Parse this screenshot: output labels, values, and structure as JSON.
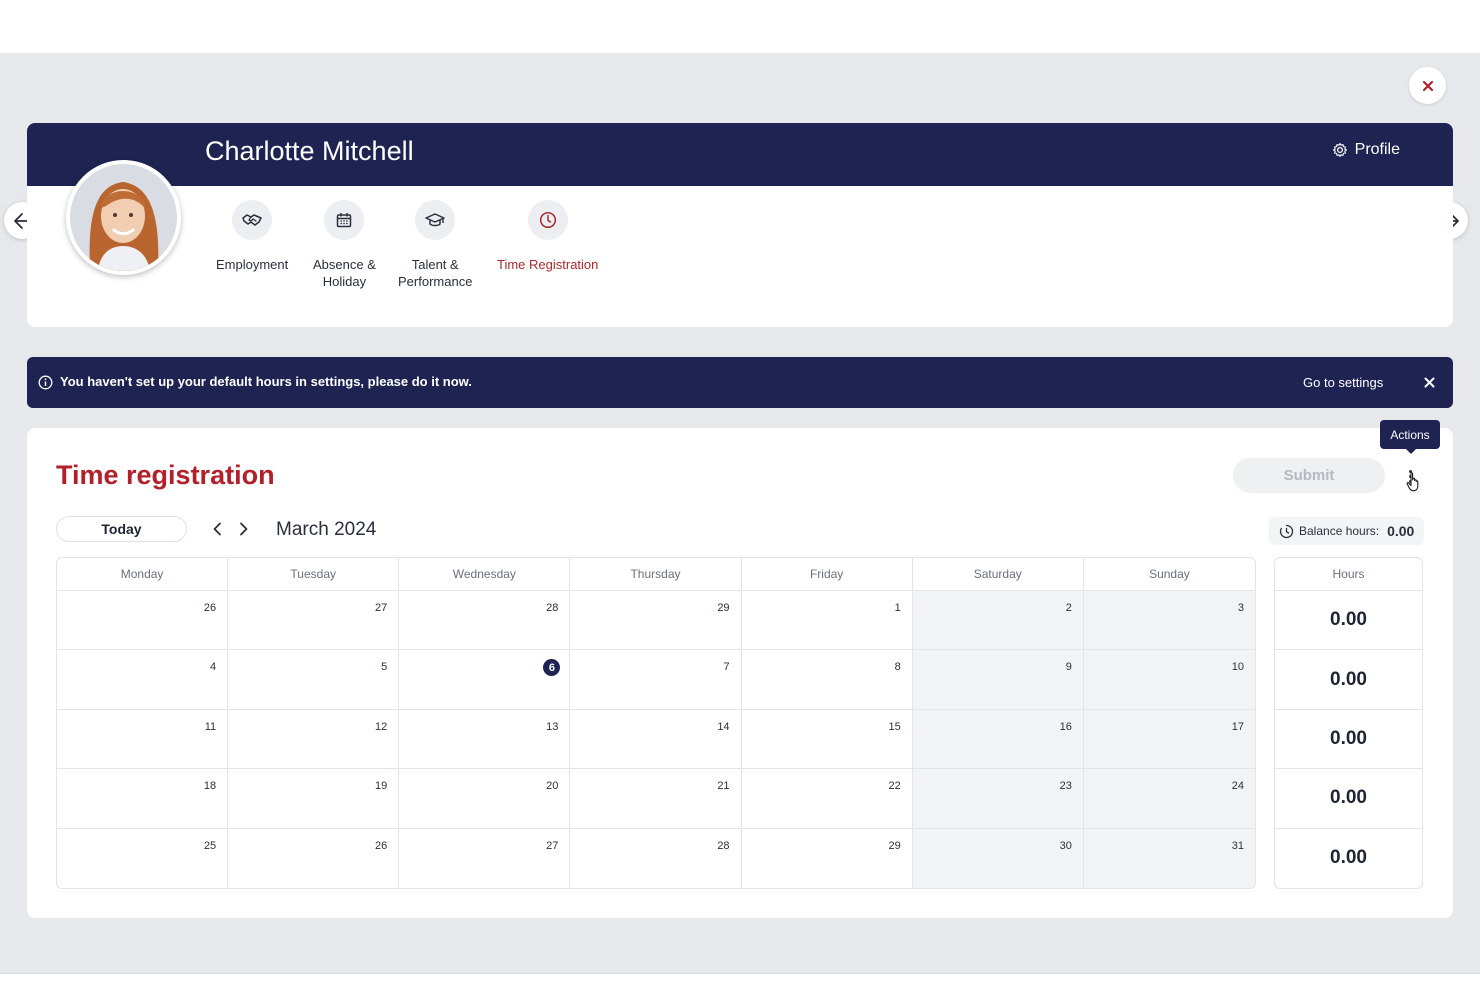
{
  "employee": {
    "name": "Charlotte Mitchell"
  },
  "header": {
    "profile_label": "Profile"
  },
  "tabs": [
    {
      "label": "Employment",
      "icon": "handshake-icon"
    },
    {
      "label": "Absence &\nHoliday",
      "icon": "calendar-icon"
    },
    {
      "label": "Talent &\nPerformance",
      "icon": "graduation-cap-icon"
    },
    {
      "label": "Time Registration",
      "icon": "clock-icon",
      "active": true
    }
  ],
  "alert": {
    "message": "You haven't set up your default hours in settings, please do it now.",
    "link": "Go to settings"
  },
  "time_registration": {
    "title": "Time registration",
    "submit_label": "Submit",
    "actions_tooltip": "Actions",
    "today_label": "Today",
    "month_label": "March 2024",
    "balance_label": "Balance hours:",
    "balance_value": "0.00",
    "weekdays": [
      "Monday",
      "Tuesday",
      "Wednesday",
      "Thursday",
      "Friday",
      "Saturday",
      "Sunday"
    ],
    "weeks": [
      [
        "26",
        "27",
        "28",
        "29",
        "1",
        "2",
        "3"
      ],
      [
        "4",
        "5",
        "6",
        "7",
        "8",
        "9",
        "10"
      ],
      [
        "11",
        "12",
        "13",
        "14",
        "15",
        "16",
        "17"
      ],
      [
        "18",
        "19",
        "20",
        "21",
        "22",
        "23",
        "24"
      ],
      [
        "25",
        "26",
        "27",
        "28",
        "29",
        "30",
        "31"
      ]
    ],
    "today_day": "6",
    "hours_header": "Hours",
    "weekly_hours": [
      "0.00",
      "0.00",
      "0.00",
      "0.00",
      "0.00"
    ]
  },
  "colors": {
    "navy": "#1e2352",
    "accent_red": "#b2202a",
    "active_tab": "#a72a2f"
  }
}
